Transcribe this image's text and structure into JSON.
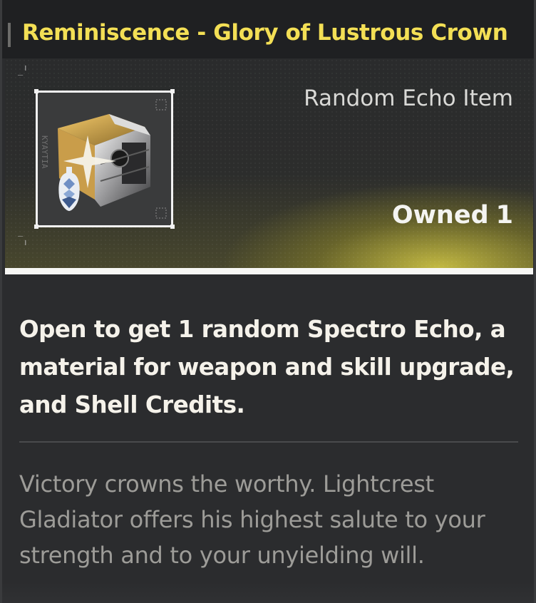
{
  "title": "Reminiscence - Glory of Lustrous Crown",
  "item": {
    "type_label": "Random Echo Item",
    "owned_label": "Owned",
    "owned_count": "1",
    "icon": "echo-chest-icon",
    "badge_icon": "gladiator-helmet-icon",
    "side_text": "KYAYTIA"
  },
  "description": "Open to get 1 random Spectro Echo, a material for weapon and skill upgrade, and Shell Credits.",
  "lore": "Victory crowns the worthy. Lightcrest Gladiator offers his highest salute to your strength and to your unyielding will.",
  "colors": {
    "title": "#f3df55",
    "accent_glow": "#d8cd46",
    "panel_bg": "#2b2c2e"
  }
}
